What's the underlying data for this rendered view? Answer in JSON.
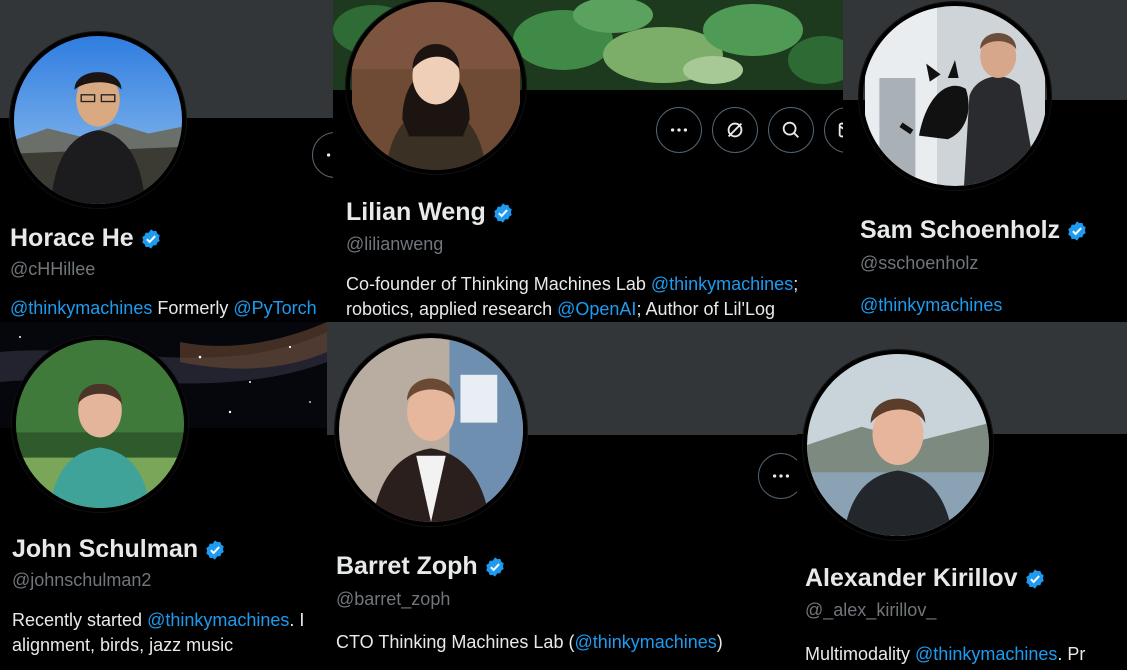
{
  "profiles": [
    {
      "id": "horace",
      "display_name": "Horace He",
      "handle": "@cHHillee",
      "bio_prefix_link": "@thinkymachines",
      "bio_text": " Formerly ",
      "bio_link2": "@PyTorch"
    },
    {
      "id": "lilian",
      "display_name": "Lilian Weng",
      "handle": "@lilianweng",
      "bio_line1_text": "Co-founder of Thinking Machines Lab ",
      "bio_line1_link": "@thinkymachines",
      "bio_line1_tail": ";",
      "bio_line2_text": "robotics, applied research ",
      "bio_line2_link": "@OpenAI",
      "bio_line2_tail": "; Author of Lil'Log"
    },
    {
      "id": "sam",
      "display_name": "Sam Schoenholz",
      "handle": "@sschoenholz",
      "bio_link": "@thinkymachines"
    },
    {
      "id": "john",
      "display_name": "John Schulman",
      "handle": "@johnschulman2",
      "bio_line1_text": "Recently started ",
      "bio_line1_link": "@thinkymachines",
      "bio_line1_tail": ". I",
      "bio_line2_text": "alignment, birds, jazz music"
    },
    {
      "id": "barret",
      "display_name": "Barret Zoph",
      "handle": "@barret_zoph",
      "bio_text": "CTO Thinking Machines Lab (",
      "bio_link": "@thinkymachines",
      "bio_tail": ")"
    },
    {
      "id": "alexander",
      "display_name": "Alexander Kirillov",
      "handle": "@_alex_kirillov_",
      "bio_text": "Multimodality ",
      "bio_link": "@thinkymachines",
      "bio_tail": ". Pr"
    }
  ],
  "icons": {
    "verified": "verified-badge-icon",
    "more": "more-options-icon",
    "grok": "grok-icon",
    "search": "search-icon",
    "message": "message-icon"
  },
  "colors": {
    "background": "#000000",
    "link": "#1d9bf0",
    "handle": "#71767b",
    "text": "#e7e9ea",
    "banner_gray": "#333639",
    "verified": "#1d9bf0"
  }
}
